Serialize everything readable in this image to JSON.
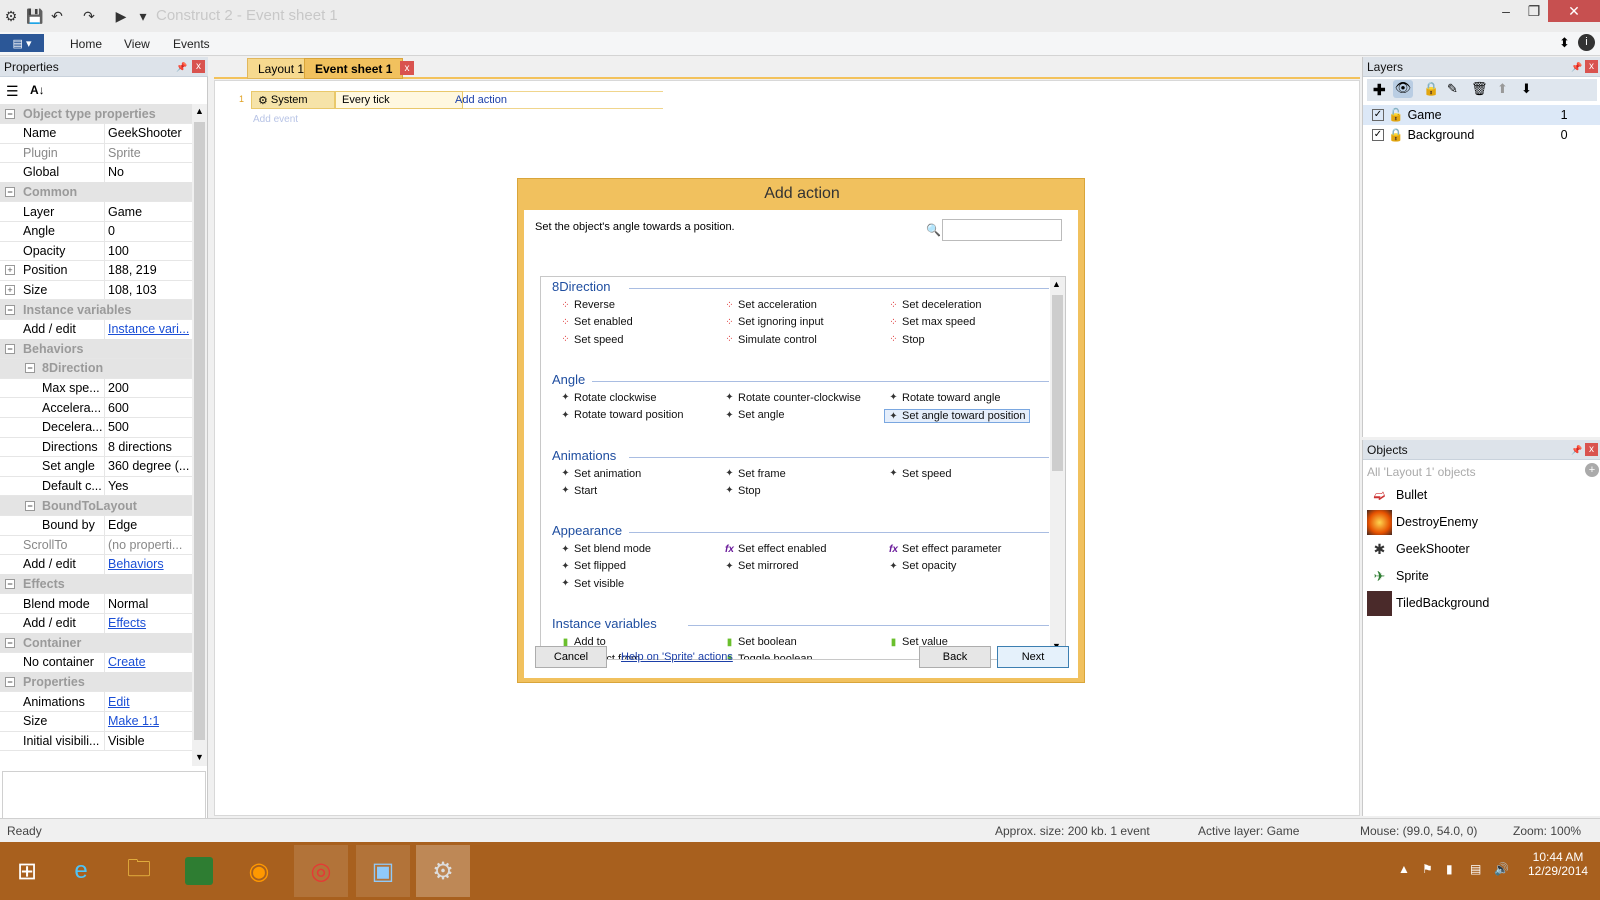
{
  "window": {
    "title": "Construct 2 - Event sheet 1"
  },
  "ribbon": {
    "tabs": [
      "Home",
      "View",
      "Events"
    ]
  },
  "properties": {
    "title": "Properties",
    "rows": [
      {
        "type": "cat",
        "name": "Object type properties"
      },
      {
        "type": "row",
        "name": "Name",
        "value": "GeekShooter"
      },
      {
        "type": "row",
        "name": "Plugin",
        "value": "Sprite",
        "dim": true
      },
      {
        "type": "row",
        "name": "Global",
        "value": "No"
      },
      {
        "type": "cat",
        "name": "Common"
      },
      {
        "type": "row",
        "name": "Layer",
        "value": "Game"
      },
      {
        "type": "row",
        "name": "Angle",
        "value": "0"
      },
      {
        "type": "row",
        "name": "Opacity",
        "value": "100"
      },
      {
        "type": "row",
        "name": "Position",
        "value": "188, 219",
        "expand": true
      },
      {
        "type": "row",
        "name": "Size",
        "value": "108, 103",
        "expand": true
      },
      {
        "type": "cat",
        "name": "Instance variables"
      },
      {
        "type": "row",
        "name": "Add / edit",
        "value": "Instance vari...",
        "link": true
      },
      {
        "type": "cat",
        "name": "Behaviors"
      },
      {
        "type": "cat",
        "name": "8Direction",
        "sub": true
      },
      {
        "type": "row",
        "name": "Max spe...",
        "value": "200",
        "indent": true
      },
      {
        "type": "row",
        "name": "Accelera...",
        "value": "600",
        "indent": true
      },
      {
        "type": "row",
        "name": "Decelera...",
        "value": "500",
        "indent": true
      },
      {
        "type": "row",
        "name": "Directions",
        "value": "8 directions",
        "indent": true
      },
      {
        "type": "row",
        "name": "Set angle",
        "value": "360 degree (...",
        "indent": true
      },
      {
        "type": "row",
        "name": "Default c...",
        "value": "Yes",
        "indent": true
      },
      {
        "type": "cat",
        "name": "BoundToLayout",
        "sub": true
      },
      {
        "type": "row",
        "name": "Bound by",
        "value": "Edge",
        "indent": true
      },
      {
        "type": "row",
        "name": "ScrollTo",
        "value": "(no properti...",
        "dim": true
      },
      {
        "type": "row",
        "name": "Add / edit",
        "value": "Behaviors",
        "link": true
      },
      {
        "type": "cat",
        "name": "Effects"
      },
      {
        "type": "row",
        "name": "Blend mode",
        "value": "Normal"
      },
      {
        "type": "row",
        "name": "Add / edit",
        "value": "Effects",
        "link": true
      },
      {
        "type": "cat",
        "name": "Container"
      },
      {
        "type": "row",
        "name": "No container",
        "value": "Create",
        "link": true
      },
      {
        "type": "cat",
        "name": "Properties"
      },
      {
        "type": "row",
        "name": "Animations",
        "value": "Edit",
        "link": true
      },
      {
        "type": "row",
        "name": "Size",
        "value": "Make 1:1",
        "link": true
      },
      {
        "type": "row",
        "name": "Initial visibili...",
        "value": "Visible"
      }
    ]
  },
  "tabs": [
    {
      "label": "Layout 1",
      "active": false
    },
    {
      "label": "Event sheet 1",
      "active": true
    }
  ],
  "event": {
    "number": "1",
    "object": "System",
    "condition": "Every tick",
    "add_action": "Add action",
    "add_event": "Add event"
  },
  "dialog": {
    "title": "Add action",
    "description": "Set the object's angle towards a position.",
    "sections": [
      {
        "name": "8Direction",
        "icon": "dir",
        "items": [
          "Reverse",
          "Set acceleration",
          "Set deceleration",
          "Set enabled",
          "Set ignoring input",
          "Set max speed",
          "Set speed",
          "Simulate control",
          "Stop"
        ]
      },
      {
        "name": "Angle",
        "icon": "spr",
        "items": [
          "Rotate clockwise",
          "Rotate counter-clockwise",
          "Rotate toward angle",
          "Rotate toward position",
          "Set angle",
          "Set angle toward position"
        ],
        "selected": "Set angle toward position"
      },
      {
        "name": "Animations",
        "icon": "spr",
        "items": [
          "Set animation",
          "Set frame",
          "Set speed",
          "Start",
          "Stop"
        ]
      },
      {
        "name": "Appearance",
        "icon": "mix",
        "items": [
          "Set blend mode",
          "Set effect enabled",
          "Set effect parameter",
          "Set flipped",
          "Set mirrored",
          "Set opacity",
          "Set visible"
        ]
      },
      {
        "name": "Instance variables",
        "icon": "var",
        "items": [
          "Add to",
          "Set boolean",
          "Set value",
          "Subtract from",
          "Toggle boolean"
        ]
      }
    ],
    "buttons": {
      "cancel": "Cancel",
      "help": "Help on 'Sprite' actions",
      "back": "Back",
      "next": "Next"
    }
  },
  "layers": {
    "title": "Layers",
    "rows": [
      {
        "name": "Game",
        "index": "1",
        "selected": true
      },
      {
        "name": "Background",
        "index": "0",
        "locked": true
      }
    ]
  },
  "objects": {
    "title": "Objects",
    "filter": "All 'Layout 1' objects",
    "items": [
      "Bullet",
      "DestroyEnemy",
      "GeekShooter",
      "Sprite",
      "TiledBackground"
    ]
  },
  "status": {
    "ready": "Ready",
    "size": "Approx. size: 200 kb. 1 event",
    "layer": "Active layer: Game",
    "mouse": "Mouse: (99.0, 54.0, 0)",
    "zoom": "Zoom: 100%"
  },
  "taskbar": {
    "time": "10:44 AM",
    "date": "12/29/2014"
  },
  "colors": {
    "accent": "#f1c15e",
    "taskbar": "#a8601e",
    "link": "#1b4fd6"
  }
}
